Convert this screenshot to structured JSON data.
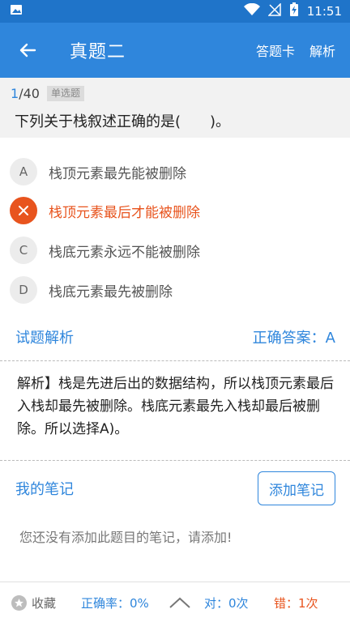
{
  "status_bar": {
    "time": "11:51",
    "icons": [
      "image-icon",
      "wifi-icon",
      "no-signal-icon",
      "battery-charging-icon"
    ]
  },
  "header": {
    "title": "真题二",
    "answer_card_label": "答题卡",
    "analysis_label": "解析"
  },
  "question": {
    "current": "1",
    "total": "/40",
    "type": "单选题",
    "text": "下列关于栈叙述正确的是(　　)。"
  },
  "options": [
    {
      "letter": "A",
      "text": "栈顶元素最先能被删除",
      "state": "normal"
    },
    {
      "letter": "B",
      "text": "栈顶元素最后才能被删除",
      "state": "wrong"
    },
    {
      "letter": "C",
      "text": "栈底元素永远不能被删除",
      "state": "normal"
    },
    {
      "letter": "D",
      "text": "栈底元素最先被删除",
      "state": "normal"
    }
  ],
  "analysis": {
    "title": "试题解析",
    "correct_answer": "正确答案：A",
    "text": "解析】栈是先进后出的数据结构，所以栈顶元素最后入栈却最先被删除。栈底元素最先入栈却最后被删除。所以选择A)。"
  },
  "notes": {
    "title": "我的笔记",
    "add_button": "添加笔记",
    "empty_text": "您还没有添加此题目的笔记，请添加!"
  },
  "bottom_bar": {
    "favorite_label": "收藏",
    "accuracy": "正确率：0%",
    "correct_count": "对：0次",
    "wrong_count": "错：1次"
  },
  "colors": {
    "primary": "#2f86dc",
    "status_bar": "#1f74c9",
    "error": "#e8541e"
  }
}
